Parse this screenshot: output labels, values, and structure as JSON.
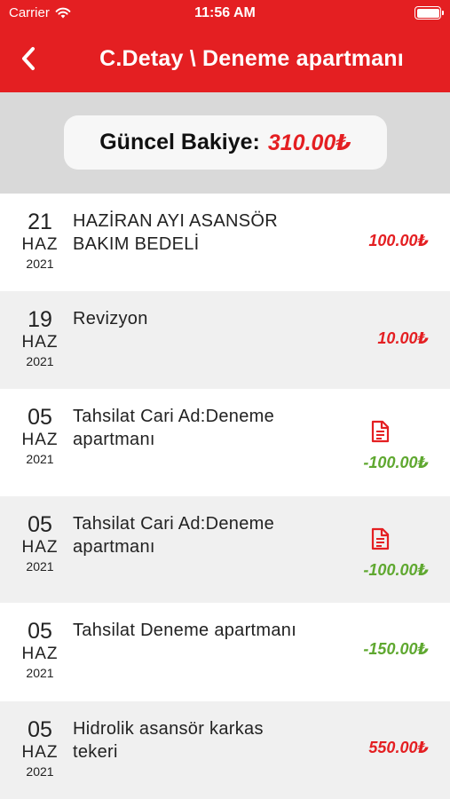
{
  "status_bar": {
    "carrier": "Carrier",
    "time": "11:56 AM"
  },
  "header": {
    "title": "C.Detay \\ Deneme apartmanı"
  },
  "balance": {
    "label": "Güncel Bakiye:",
    "value": "310.00₺"
  },
  "colors": {
    "brand_red": "#e41f22",
    "credit_green": "#5fa830"
  },
  "icons": {
    "back": "chevron-left-icon",
    "receipt": "document-icon",
    "wifi": "wifi-icon",
    "battery": "battery-icon"
  },
  "transactions": [
    {
      "day": "21",
      "month": "HAZ",
      "year": "2021",
      "description": "HAZİRAN AYI ASANSÖR BAKIM BEDELİ",
      "amount": "100.00₺",
      "type": "debit",
      "has_receipt": false
    },
    {
      "day": "19",
      "month": "HAZ",
      "year": "2021",
      "description": "Revizyon",
      "amount": "10.00₺",
      "type": "debit",
      "has_receipt": false
    },
    {
      "day": "05",
      "month": "HAZ",
      "year": "2021",
      "description": "Tahsilat Cari Ad:Deneme apartmanı",
      "amount": "-100.00₺",
      "type": "credit",
      "has_receipt": true
    },
    {
      "day": "05",
      "month": "HAZ",
      "year": "2021",
      "description": "Tahsilat Cari Ad:Deneme apartmanı",
      "amount": "-100.00₺",
      "type": "credit",
      "has_receipt": true
    },
    {
      "day": "05",
      "month": "HAZ",
      "year": "2021",
      "description": "Tahsilat Deneme apartmanı",
      "amount": "-150.00₺",
      "type": "credit",
      "has_receipt": false
    },
    {
      "day": "05",
      "month": "HAZ",
      "year": "2021",
      "description": "Hidrolik asansör karkas tekeri",
      "amount": "550.00₺",
      "type": "debit",
      "has_receipt": false
    }
  ]
}
